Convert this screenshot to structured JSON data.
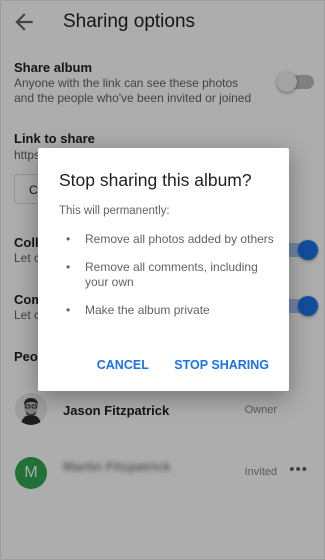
{
  "header": {
    "title": "Sharing options"
  },
  "share_album": {
    "title": "Share album",
    "description": "Anyone with the link can see these photos and the people who've been invited or joined"
  },
  "link_to_share": {
    "title": "Link to share",
    "url_partial": "https",
    "copy_partial": "Co"
  },
  "collaborate": {
    "title_partial": "Colla",
    "desc_partial": "Let c"
  },
  "comments": {
    "title_partial": "Com",
    "desc_partial": "Let c"
  },
  "people": {
    "heading_partial": "Peop",
    "members": [
      {
        "name": "Jason Fitzpatrick",
        "role": "Owner"
      },
      {
        "initial": "M",
        "name": "Martin Fitzpatrick",
        "role": "Invited"
      }
    ]
  },
  "dialog": {
    "title": "Stop sharing this album?",
    "intro": "This will permanently:",
    "bullet": "•",
    "items": [
      "Remove all photos added by others",
      "Remove all comments, including your own",
      "Make the album private"
    ],
    "cancel_label": "CANCEL",
    "confirm_label": "STOP SHARING"
  },
  "colors": {
    "accent": "#1a73e8",
    "toggle_off": "#bdbdbd",
    "avatar_green": "#33a852",
    "scrim": "rgba(0,0,0,0.32)"
  },
  "icons": {
    "back": "arrow-back-icon",
    "more": "more-horiz-icon"
  }
}
